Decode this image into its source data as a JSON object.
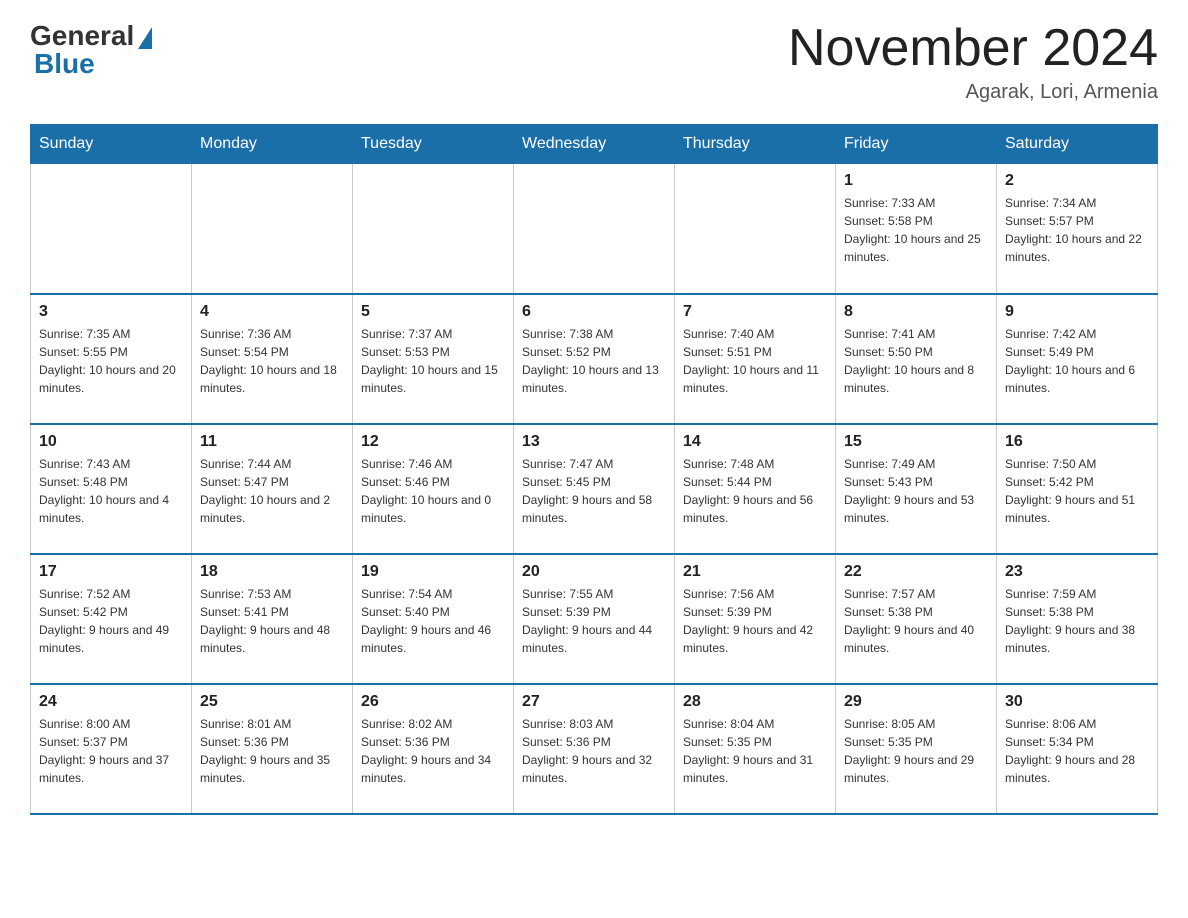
{
  "header": {
    "logo_general": "General",
    "logo_blue": "Blue",
    "month_title": "November 2024",
    "location": "Agarak, Lori, Armenia"
  },
  "days_of_week": [
    "Sunday",
    "Monday",
    "Tuesday",
    "Wednesday",
    "Thursday",
    "Friday",
    "Saturday"
  ],
  "weeks": [
    [
      {
        "day": "",
        "info": ""
      },
      {
        "day": "",
        "info": ""
      },
      {
        "day": "",
        "info": ""
      },
      {
        "day": "",
        "info": ""
      },
      {
        "day": "",
        "info": ""
      },
      {
        "day": "1",
        "info": "Sunrise: 7:33 AM\nSunset: 5:58 PM\nDaylight: 10 hours and 25 minutes."
      },
      {
        "day": "2",
        "info": "Sunrise: 7:34 AM\nSunset: 5:57 PM\nDaylight: 10 hours and 22 minutes."
      }
    ],
    [
      {
        "day": "3",
        "info": "Sunrise: 7:35 AM\nSunset: 5:55 PM\nDaylight: 10 hours and 20 minutes."
      },
      {
        "day": "4",
        "info": "Sunrise: 7:36 AM\nSunset: 5:54 PM\nDaylight: 10 hours and 18 minutes."
      },
      {
        "day": "5",
        "info": "Sunrise: 7:37 AM\nSunset: 5:53 PM\nDaylight: 10 hours and 15 minutes."
      },
      {
        "day": "6",
        "info": "Sunrise: 7:38 AM\nSunset: 5:52 PM\nDaylight: 10 hours and 13 minutes."
      },
      {
        "day": "7",
        "info": "Sunrise: 7:40 AM\nSunset: 5:51 PM\nDaylight: 10 hours and 11 minutes."
      },
      {
        "day": "8",
        "info": "Sunrise: 7:41 AM\nSunset: 5:50 PM\nDaylight: 10 hours and 8 minutes."
      },
      {
        "day": "9",
        "info": "Sunrise: 7:42 AM\nSunset: 5:49 PM\nDaylight: 10 hours and 6 minutes."
      }
    ],
    [
      {
        "day": "10",
        "info": "Sunrise: 7:43 AM\nSunset: 5:48 PM\nDaylight: 10 hours and 4 minutes."
      },
      {
        "day": "11",
        "info": "Sunrise: 7:44 AM\nSunset: 5:47 PM\nDaylight: 10 hours and 2 minutes."
      },
      {
        "day": "12",
        "info": "Sunrise: 7:46 AM\nSunset: 5:46 PM\nDaylight: 10 hours and 0 minutes."
      },
      {
        "day": "13",
        "info": "Sunrise: 7:47 AM\nSunset: 5:45 PM\nDaylight: 9 hours and 58 minutes."
      },
      {
        "day": "14",
        "info": "Sunrise: 7:48 AM\nSunset: 5:44 PM\nDaylight: 9 hours and 56 minutes."
      },
      {
        "day": "15",
        "info": "Sunrise: 7:49 AM\nSunset: 5:43 PM\nDaylight: 9 hours and 53 minutes."
      },
      {
        "day": "16",
        "info": "Sunrise: 7:50 AM\nSunset: 5:42 PM\nDaylight: 9 hours and 51 minutes."
      }
    ],
    [
      {
        "day": "17",
        "info": "Sunrise: 7:52 AM\nSunset: 5:42 PM\nDaylight: 9 hours and 49 minutes."
      },
      {
        "day": "18",
        "info": "Sunrise: 7:53 AM\nSunset: 5:41 PM\nDaylight: 9 hours and 48 minutes."
      },
      {
        "day": "19",
        "info": "Sunrise: 7:54 AM\nSunset: 5:40 PM\nDaylight: 9 hours and 46 minutes."
      },
      {
        "day": "20",
        "info": "Sunrise: 7:55 AM\nSunset: 5:39 PM\nDaylight: 9 hours and 44 minutes."
      },
      {
        "day": "21",
        "info": "Sunrise: 7:56 AM\nSunset: 5:39 PM\nDaylight: 9 hours and 42 minutes."
      },
      {
        "day": "22",
        "info": "Sunrise: 7:57 AM\nSunset: 5:38 PM\nDaylight: 9 hours and 40 minutes."
      },
      {
        "day": "23",
        "info": "Sunrise: 7:59 AM\nSunset: 5:38 PM\nDaylight: 9 hours and 38 minutes."
      }
    ],
    [
      {
        "day": "24",
        "info": "Sunrise: 8:00 AM\nSunset: 5:37 PM\nDaylight: 9 hours and 37 minutes."
      },
      {
        "day": "25",
        "info": "Sunrise: 8:01 AM\nSunset: 5:36 PM\nDaylight: 9 hours and 35 minutes."
      },
      {
        "day": "26",
        "info": "Sunrise: 8:02 AM\nSunset: 5:36 PM\nDaylight: 9 hours and 34 minutes."
      },
      {
        "day": "27",
        "info": "Sunrise: 8:03 AM\nSunset: 5:36 PM\nDaylight: 9 hours and 32 minutes."
      },
      {
        "day": "28",
        "info": "Sunrise: 8:04 AM\nSunset: 5:35 PM\nDaylight: 9 hours and 31 minutes."
      },
      {
        "day": "29",
        "info": "Sunrise: 8:05 AM\nSunset: 5:35 PM\nDaylight: 9 hours and 29 minutes."
      },
      {
        "day": "30",
        "info": "Sunrise: 8:06 AM\nSunset: 5:34 PM\nDaylight: 9 hours and 28 minutes."
      }
    ]
  ]
}
